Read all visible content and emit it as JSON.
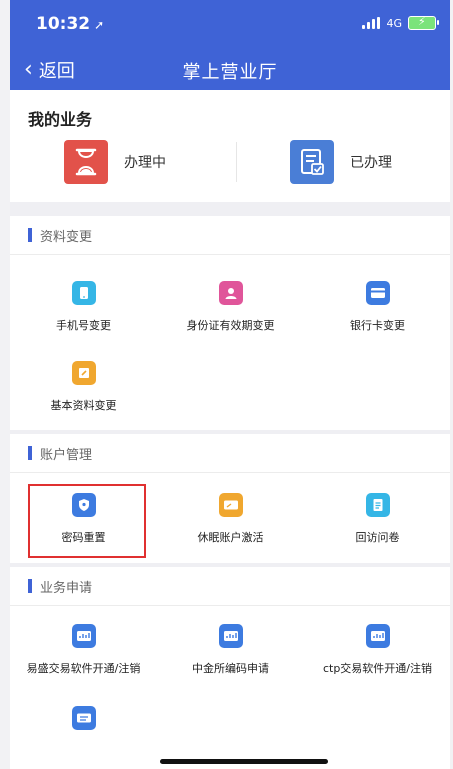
{
  "status_bar": {
    "time": "10:32",
    "network": "4G"
  },
  "nav": {
    "back_label": "返回",
    "title": "掌上营业厅"
  },
  "my_business": {
    "title": "我的业务",
    "items": [
      {
        "label": "办理中",
        "icon": "hourglass-icon",
        "color": "#e2524a"
      },
      {
        "label": "已办理",
        "icon": "document-check-icon",
        "color": "#4a7ed6"
      }
    ]
  },
  "sections": [
    {
      "title": "资料变更",
      "items": [
        {
          "label": "手机号变更",
          "icon": "phone-icon",
          "color": "#35b6e6"
        },
        {
          "label": "身份证有效期变更",
          "icon": "id-person-icon",
          "color": "#e0559a"
        },
        {
          "label": "银行卡变更",
          "icon": "bank-card-icon",
          "color": "#3d7be0"
        },
        {
          "label": "基本资料变更",
          "icon": "profile-edit-icon",
          "color": "#f0a72f"
        }
      ]
    },
    {
      "title": "账户管理",
      "items": [
        {
          "label": "密码重置",
          "icon": "shield-icon",
          "color": "#3d7be0"
        },
        {
          "label": "休眠账户激活",
          "icon": "card-activate-icon",
          "color": "#f0a72f"
        },
        {
          "label": "回访问卷",
          "icon": "questionnaire-icon",
          "color": "#35b6e6"
        }
      ]
    },
    {
      "title": "业务申请",
      "items": [
        {
          "label": "易盛交易软件开通/注销",
          "icon": "trading-software-icon",
          "color": "#3d7be0"
        },
        {
          "label": "中金所编码申请",
          "icon": "trading-software-icon",
          "color": "#3d7be0"
        },
        {
          "label": "ctp交易软件开通/注销",
          "icon": "trading-software-icon",
          "color": "#3d7be0"
        },
        {
          "label": "",
          "icon": "id-card-icon",
          "color": "#3d7be0"
        }
      ]
    }
  ]
}
